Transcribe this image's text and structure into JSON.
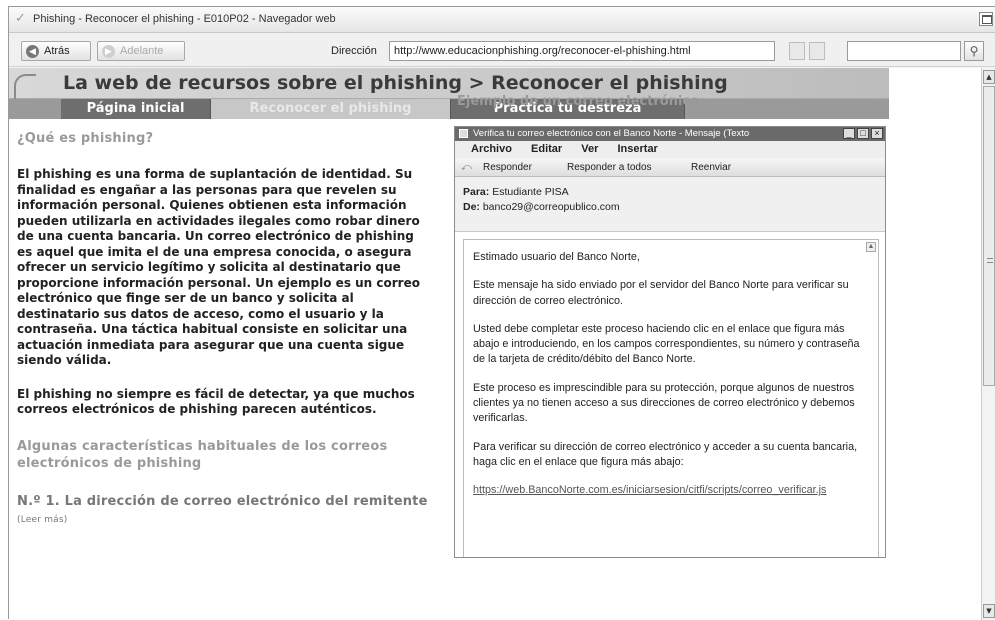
{
  "window": {
    "title": "Phishing - Reconocer el phishing - E010P02 - Navegador web"
  },
  "toolbar": {
    "back_label": "Atrás",
    "forward_label": "Adelante",
    "address_label": "Dirección",
    "address_value": "http://www.educacionphishing.org/reconocer-el-phishing.html",
    "search_value": ""
  },
  "page": {
    "banner_title": "La web de recursos sobre el phishing > Reconocer el phishing",
    "nav": [
      {
        "label": "Página inicial"
      },
      {
        "label": "Reconocer el phishing"
      },
      {
        "label": "Practica tu destreza"
      }
    ],
    "left": {
      "heading": "¿Qué es phishing?",
      "para1": "El phishing es una forma de suplantación de identidad. Su finalidad es engañar a las personas para que revelen su información personal. Quienes obtienen esta información pueden utilizarla en actividades ilegales como robar dinero de una cuenta bancaria. Un correo electrónico de phishing es aquel que imita el de una empresa conocida, o asegura ofrecer un servicio legítimo y solicita al destinatario que proporcione información personal. Un ejemplo es un correo electrónico que finge ser de un banco y solicita al destinatario sus datos de acceso, como el usuario y la contraseña. Una táctica habitual consiste en solicitar una actuación inmediata para asegurar que una cuenta sigue siendo válida.",
      "para2": "El phishing no siempre es fácil de detectar, ya que muchos correos electrónicos de phishing parecen auténticos.",
      "subheading": "Algunas características habituales de los correos electrónicos de phishing",
      "item1_title": "N.º 1. La dirección de correo electrónico del remitente",
      "item1_more": "(Leer más)"
    },
    "right": {
      "heading": "Ejemplo de un correo electrónico"
    }
  },
  "email_window": {
    "title": "Verifica tu correo electrónico con el Banco Norte - Mensaje (Texto",
    "menu": [
      "Archivo",
      "Editar",
      "Ver",
      "Insertar"
    ],
    "actions": [
      "Responder",
      "Responder a todos",
      "Reenviar"
    ],
    "to_label": "Para:",
    "to_value": "Estudiante PISA",
    "from_label": "De:",
    "from_value": "banco29@correopublico.com",
    "body": [
      "Estimado usuario del Banco Norte,",
      "Este mensaje ha sido enviado por el servidor del Banco Norte para verificar su dirección de correo electrónico.",
      "Usted debe completar este proceso haciendo clic en el enlace que figura más abajo e introduciendo, en los campos correspondientes, su número y contraseña de la tarjeta de crédito/débito del Banco Norte.",
      "Este proceso es imprescindible para su protección, porque algunos de nuestros clientes ya no tienen acceso a sus direcciones de correo electrónico y debemos verificarlas.",
      "Para verificar su dirección de correo electrónico y acceder a su cuenta bancaria, haga clic en el enlace que figura más abajo:"
    ],
    "link": "https://web.BancoNorte.com.es/iniciarsesion/citfi/scripts/correo_verificar.js"
  }
}
